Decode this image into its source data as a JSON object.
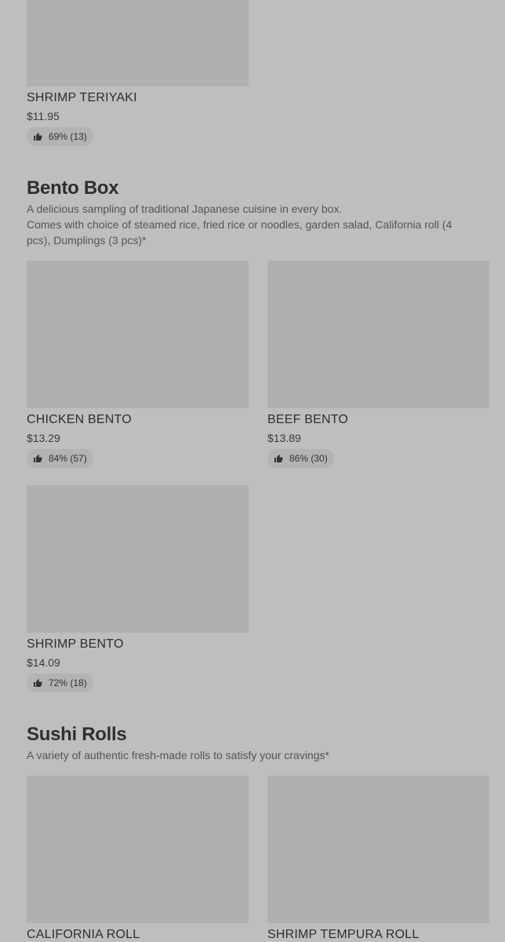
{
  "top_item": {
    "name": "SHRIMP TERIYAKI",
    "price": "$11.95",
    "rating": "69% (13)"
  },
  "bento": {
    "title": "Bento Box",
    "description_line1": "A delicious sampling of traditional Japanese cuisine in every box.",
    "description_line2": "Comes with choice of steamed rice, fried rice or noodles, garden salad, California roll (4 pcs), Dumplings (3 pcs)*",
    "items": [
      {
        "name": "CHICKEN BENTO",
        "price": "$13.29",
        "rating": "84% (57)"
      },
      {
        "name": "BEEF BENTO",
        "price": "$13.89",
        "rating": "86% (30)"
      },
      {
        "name": "SHRIMP BENTO",
        "price": "$14.09",
        "rating": "72% (18)"
      }
    ]
  },
  "sushi": {
    "title": "Sushi Rolls",
    "description": "A variety of authentic fresh-made rolls to satisfy your cravings*",
    "items": [
      {
        "name": "CALIFORNIA ROLL"
      },
      {
        "name": "SHRIMP TEMPURA ROLL"
      }
    ]
  },
  "colors": {
    "background": "#bebebe",
    "image_placeholder": "#b0b0b0",
    "rating_pill": "#b3b3b3"
  },
  "icons": {
    "rating": "thumbs-up-icon"
  }
}
